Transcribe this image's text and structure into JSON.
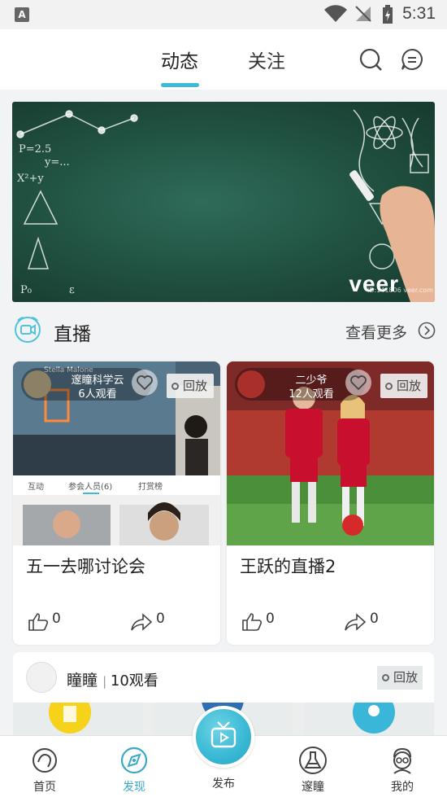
{
  "status_bar": {
    "time": "5:31",
    "app_icon": "A"
  },
  "header": {
    "tabs": [
      {
        "label": "动态"
      },
      {
        "label": "关注"
      }
    ],
    "accent": "#3bbbd9"
  },
  "banner": {
    "watermark": "veer",
    "code": "ID:141806 veer.com"
  },
  "live": {
    "title": "直播",
    "more": "查看更多"
  },
  "cards": [
    {
      "host": "邃瞳科学云",
      "viewers": "6人观看",
      "badge": "回放",
      "title": "五一去哪讨论会",
      "likes": "0",
      "shares": "0",
      "screen": {
        "user": "Stella Malone",
        "tabs": [
          "互动",
          "参会人员(6)",
          "打赏榜"
        ]
      }
    },
    {
      "host": "二少爷",
      "viewers": "12人观看",
      "badge": "回放",
      "title": "王跃的直播2",
      "likes": "0",
      "shares": "0"
    }
  ],
  "card3": {
    "name": "瞳瞳",
    "views": "10观看",
    "badge": "回放"
  },
  "nav": [
    {
      "label": "首页"
    },
    {
      "label": "发现"
    },
    {
      "label": "发布"
    },
    {
      "label": "邃瞳"
    },
    {
      "label": "我的"
    }
  ]
}
